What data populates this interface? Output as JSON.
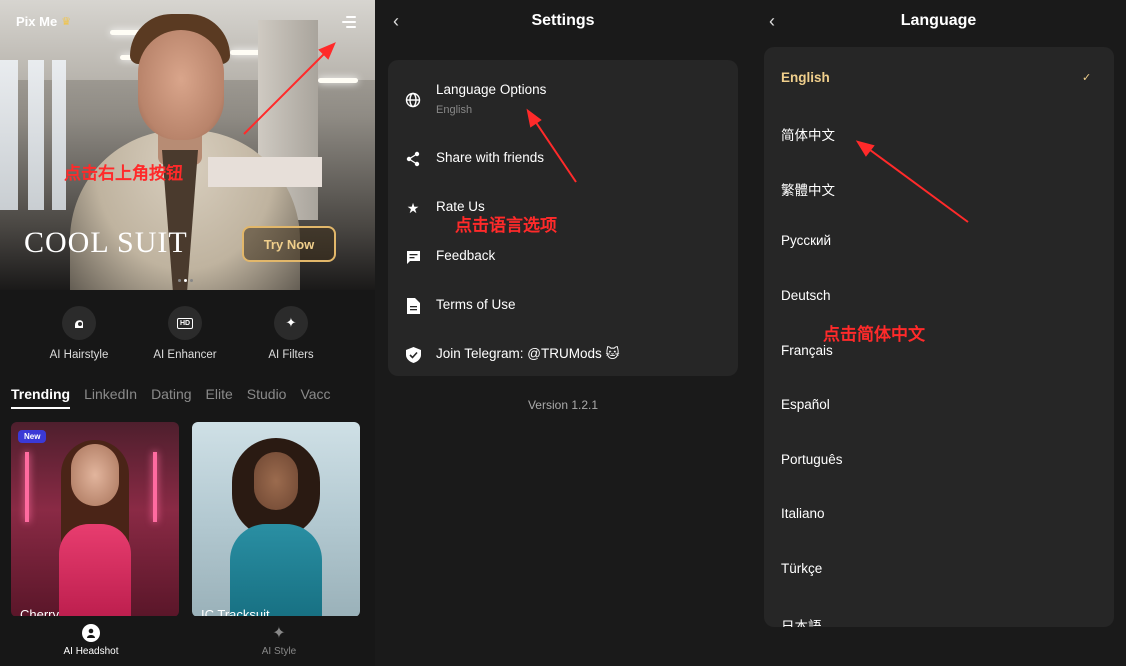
{
  "home": {
    "app_name": "Pix Me",
    "banner_title": "COOL SUIT",
    "try_now": "Try Now",
    "features": [
      {
        "label": "AI Hairstyle",
        "icon": "hairstyle-icon"
      },
      {
        "label": "AI Enhancer",
        "icon": "hd-icon",
        "badge": "HD"
      },
      {
        "label": "AI Filters",
        "icon": "sparkle-icon"
      }
    ],
    "tabs": [
      "Trending",
      "LinkedIn",
      "Dating",
      "Elite",
      "Studio",
      "Vacc"
    ],
    "cards": [
      {
        "name": "Cherry",
        "badge": "New"
      },
      {
        "name": "IC Tracksuit"
      }
    ],
    "nav": [
      {
        "label": "AI Headshot",
        "icon": "person-icon"
      },
      {
        "label": "AI Style",
        "icon": "sparkle-icon"
      }
    ],
    "annotation": "点击右上角按钮"
  },
  "settings": {
    "title": "Settings",
    "items": [
      {
        "title": "Language Options",
        "subtitle": "English",
        "icon": "globe-icon"
      },
      {
        "title": "Share with friends",
        "icon": "share-icon"
      },
      {
        "title": "Rate Us",
        "icon": "star-icon"
      },
      {
        "title": "Feedback",
        "icon": "feedback-icon"
      },
      {
        "title": "Terms of Use",
        "icon": "document-icon"
      },
      {
        "title": "Join Telegram: @TRUMods 🐱",
        "icon": "shield-icon"
      }
    ],
    "version": "Version 1.2.1",
    "annotation": "点击语言选项"
  },
  "language": {
    "title": "Language",
    "selected": "English",
    "options": [
      "English",
      "简体中文",
      "繁體中文",
      "Русский",
      "Deutsch",
      "Français",
      "Español",
      "Português",
      "Italiano",
      "Türkçe",
      "日本語"
    ],
    "check": "✓",
    "annotation": "点击简体中文"
  },
  "colors": {
    "accent_gold": "#f0cf8c",
    "annotation_red": "#ff2a2a",
    "card_bg": "#262626"
  }
}
